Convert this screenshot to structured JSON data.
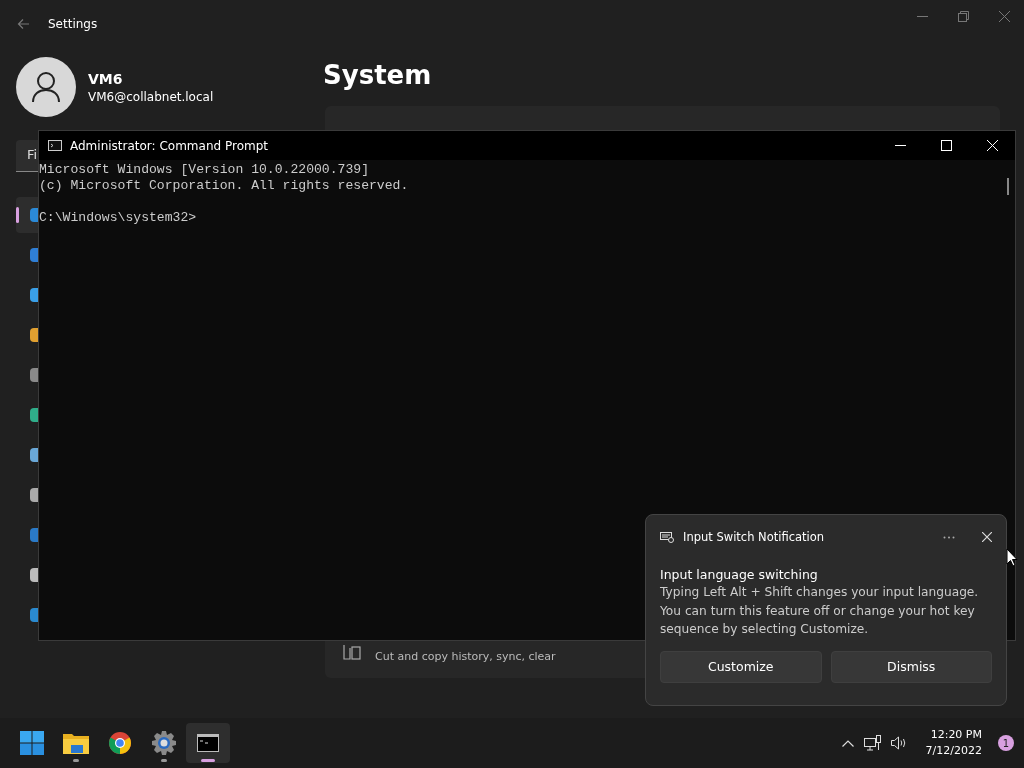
{
  "settings": {
    "title": "Settings",
    "user": {
      "name": "VM6",
      "email": "VM6@collabnet.local"
    },
    "search": {
      "value": "Fi"
    },
    "nav_items": [
      {
        "selected": true
      },
      {
        "selected": false
      },
      {
        "selected": false
      },
      {
        "selected": false
      },
      {
        "selected": false
      },
      {
        "selected": false
      },
      {
        "selected": false
      },
      {
        "selected": false
      },
      {
        "selected": false
      },
      {
        "selected": false
      },
      {
        "selected": false
      }
    ],
    "page_title": "System",
    "rows": [
      {
        "description": "Cut and copy history, sync, clear"
      }
    ]
  },
  "command_prompt": {
    "title": "Administrator: Command Prompt",
    "blocks": [
      [
        "Microsoft Windows [Version 10.0.22000.739]",
        "(c) Microsoft Corporation. All rights reserved."
      ],
      [
        "C:\\Windows\\system32>"
      ]
    ]
  },
  "notification": {
    "app": "Input Switch Notification",
    "title": "Input language switching",
    "body": "Typing Left Alt + Shift changes your input language. You can turn this feature off or change your hot key sequence by selecting Customize.",
    "buttons": [
      "Customize",
      "Dismiss"
    ]
  },
  "taskbar": {
    "apps": [
      {
        "kind": "start",
        "running": false,
        "selected": false
      },
      {
        "kind": "explorer",
        "running": true,
        "selected": false
      },
      {
        "kind": "chrome",
        "running": false,
        "selected": false
      },
      {
        "kind": "settings",
        "running": true,
        "selected": false
      },
      {
        "kind": "terminal",
        "running": true,
        "selected": true
      }
    ],
    "time": "12:20 PM",
    "date": "7/12/2022",
    "notification_count": "1"
  }
}
